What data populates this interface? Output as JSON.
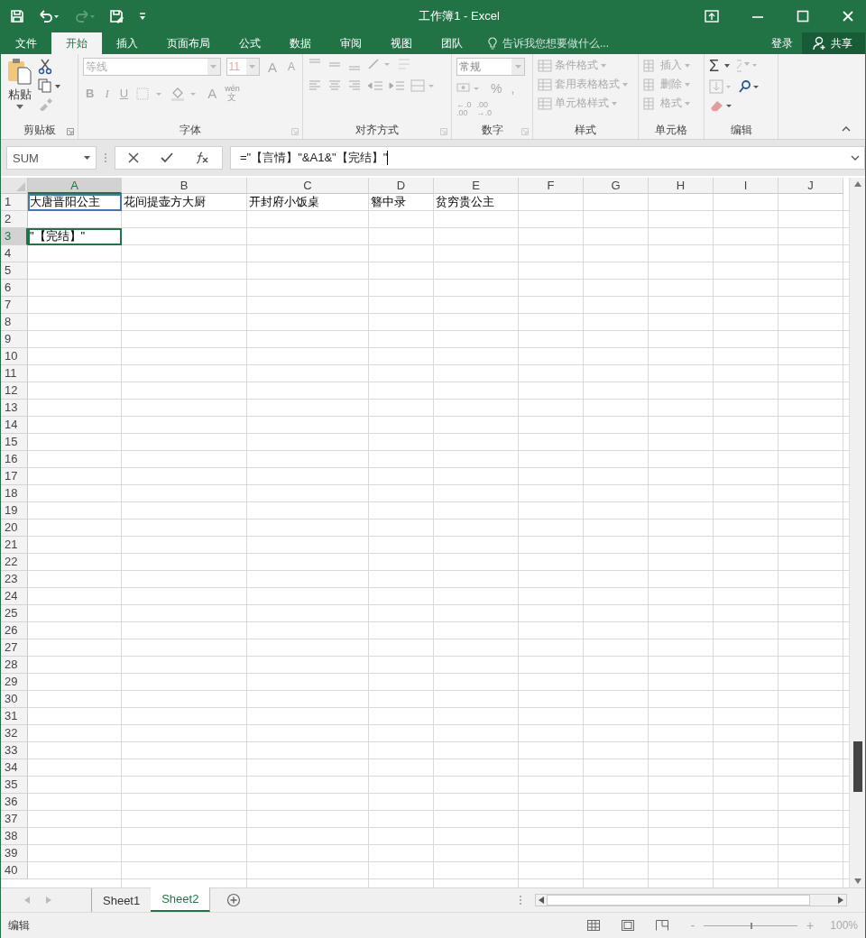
{
  "window": {
    "title": "工作簿1 - Excel"
  },
  "menu_tabs": [
    {
      "label": "文件",
      "selected": false
    },
    {
      "label": "开始",
      "selected": true
    },
    {
      "label": "插入",
      "selected": false
    },
    {
      "label": "页面布局",
      "selected": false
    },
    {
      "label": "公式",
      "selected": false
    },
    {
      "label": "数据",
      "selected": false
    },
    {
      "label": "审阅",
      "selected": false
    },
    {
      "label": "视图",
      "selected": false
    },
    {
      "label": "团队",
      "selected": false
    }
  ],
  "tell_me": {
    "placeholder": "告诉我您想要做什么..."
  },
  "sign_in": "登录",
  "share": "共享",
  "ribbon": {
    "clipboard": {
      "paste": "粘贴",
      "label": "剪贴板"
    },
    "font": {
      "name": "等线",
      "size": "11",
      "grow": "A",
      "shrink": "A",
      "bold": "B",
      "italic": "I",
      "underline": "U",
      "font_color": "A",
      "phonetic_top": "wén",
      "phonetic_bottom": "文",
      "label": "字体"
    },
    "alignment": {
      "label": "对齐方式"
    },
    "number": {
      "format": "常规",
      "percent": "%",
      "comma": ",",
      "increase_decimal": [
        "←.0",
        ".00"
      ],
      "decrease_decimal": [
        ".00",
        "→.0"
      ],
      "label": "数字"
    },
    "styles": {
      "items": [
        "条件格式",
        "套用表格格式",
        "单元格样式"
      ],
      "label": "样式"
    },
    "cells": {
      "items": [
        "插入",
        "删除",
        "格式"
      ],
      "label": "单元格"
    },
    "editing": {
      "sum": "Σ",
      "label": "编辑"
    }
  },
  "formula_bar": {
    "name_box": "SUM",
    "formula": "=\"【言情】\"&A1&\"【完结】\""
  },
  "columns": [
    {
      "label": "A",
      "selected": true
    },
    {
      "label": "B",
      "selected": false
    },
    {
      "label": "C",
      "selected": false
    },
    {
      "label": "D",
      "selected": false
    },
    {
      "label": "E",
      "selected": false
    },
    {
      "label": "F",
      "selected": false
    },
    {
      "label": "G",
      "selected": false
    },
    {
      "label": "H",
      "selected": false
    },
    {
      "label": "I",
      "selected": false
    },
    {
      "label": "J",
      "selected": false
    }
  ],
  "rows": [
    {
      "header": "1",
      "selected": false,
      "cells": [
        {
          "text": "大唐晋阳公主",
          "referenced": true,
          "active": false
        },
        {
          "text": "花间提壶方大厨",
          "referenced": false,
          "active": false
        },
        {
          "text": "开封府小饭桌",
          "referenced": false,
          "active": false
        },
        {
          "text": "簪中录",
          "referenced": false,
          "active": false
        },
        {
          "text": "贫穷贵公主",
          "referenced": false,
          "active": false
        }
      ]
    },
    {
      "header": "2",
      "selected": false
    },
    {
      "header": "3",
      "selected": true,
      "cells": [
        {
          "text": "\"【完结】\"",
          "referenced": false,
          "active": true
        }
      ]
    },
    {
      "header": "4",
      "selected": false
    },
    {
      "header": "5",
      "selected": false
    },
    {
      "header": "6",
      "selected": false
    },
    {
      "header": "7",
      "selected": false
    },
    {
      "header": "8",
      "selected": false
    },
    {
      "header": "9",
      "selected": false
    },
    {
      "header": "10",
      "selected": false
    },
    {
      "header": "11",
      "selected": false
    },
    {
      "header": "12",
      "selected": false
    },
    {
      "header": "13",
      "selected": false
    },
    {
      "header": "14",
      "selected": false
    },
    {
      "header": "15",
      "selected": false
    },
    {
      "header": "16",
      "selected": false
    },
    {
      "header": "17",
      "selected": false
    },
    {
      "header": "18",
      "selected": false
    },
    {
      "header": "19",
      "selected": false
    },
    {
      "header": "20",
      "selected": false
    },
    {
      "header": "21",
      "selected": false
    },
    {
      "header": "22",
      "selected": false
    },
    {
      "header": "23",
      "selected": false
    },
    {
      "header": "24",
      "selected": false
    },
    {
      "header": "25",
      "selected": false
    },
    {
      "header": "26",
      "selected": false
    },
    {
      "header": "27",
      "selected": false
    },
    {
      "header": "28",
      "selected": false
    },
    {
      "header": "29",
      "selected": false
    },
    {
      "header": "30",
      "selected": false
    },
    {
      "header": "31",
      "selected": false
    },
    {
      "header": "32",
      "selected": false
    },
    {
      "header": "33",
      "selected": false
    },
    {
      "header": "34",
      "selected": false
    },
    {
      "header": "35",
      "selected": false
    },
    {
      "header": "36",
      "selected": false
    },
    {
      "header": "37",
      "selected": false
    },
    {
      "header": "38",
      "selected": false
    },
    {
      "header": "39",
      "selected": false
    },
    {
      "header": "40",
      "selected": false
    }
  ],
  "sheets": [
    {
      "label": "Sheet1",
      "selected": false
    },
    {
      "label": "Sheet2",
      "selected": true
    }
  ],
  "status_bar": {
    "mode": "编辑",
    "zoom_out": "-",
    "zoom_in": "+",
    "zoom_slider": {
      "level": 0.5
    },
    "zoom": "100%"
  }
}
